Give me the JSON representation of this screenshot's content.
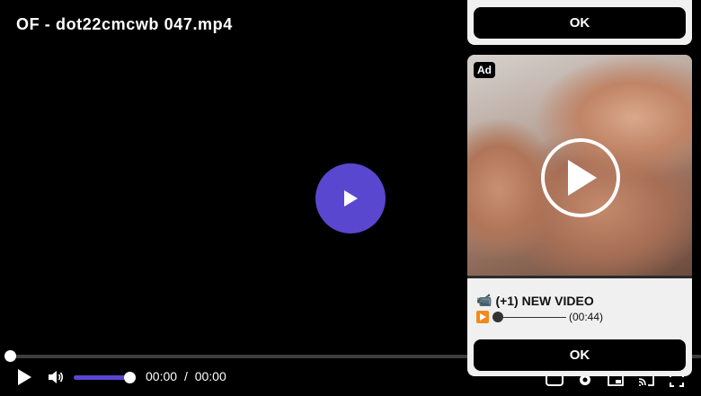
{
  "video": {
    "title": "OF - dot22cmcwb 047.mp4",
    "progress": 0.0,
    "volume": 1.0,
    "current_time": "00:00",
    "separator": "/",
    "duration": "00:00"
  },
  "colors": {
    "accent": "#5a47cf",
    "ok_button": "#000000",
    "card_bg": "#f0f0f0",
    "mini_play": "#f08a1c"
  },
  "icons": {
    "big_play": "play-icon",
    "play": "play-icon",
    "volume": "volume-icon",
    "right_controls": [
      "subtitles-icon",
      "gear-icon",
      "picture-in-picture-icon",
      "cast-icon",
      "fullscreen-icon"
    ]
  },
  "ad": {
    "top_ok_label": "OK",
    "badge": "Ad",
    "headline_icon": "📹",
    "headline": "(+1) NEW VIDEO",
    "sub_time": "(00:44)",
    "ok_label": "OK"
  }
}
